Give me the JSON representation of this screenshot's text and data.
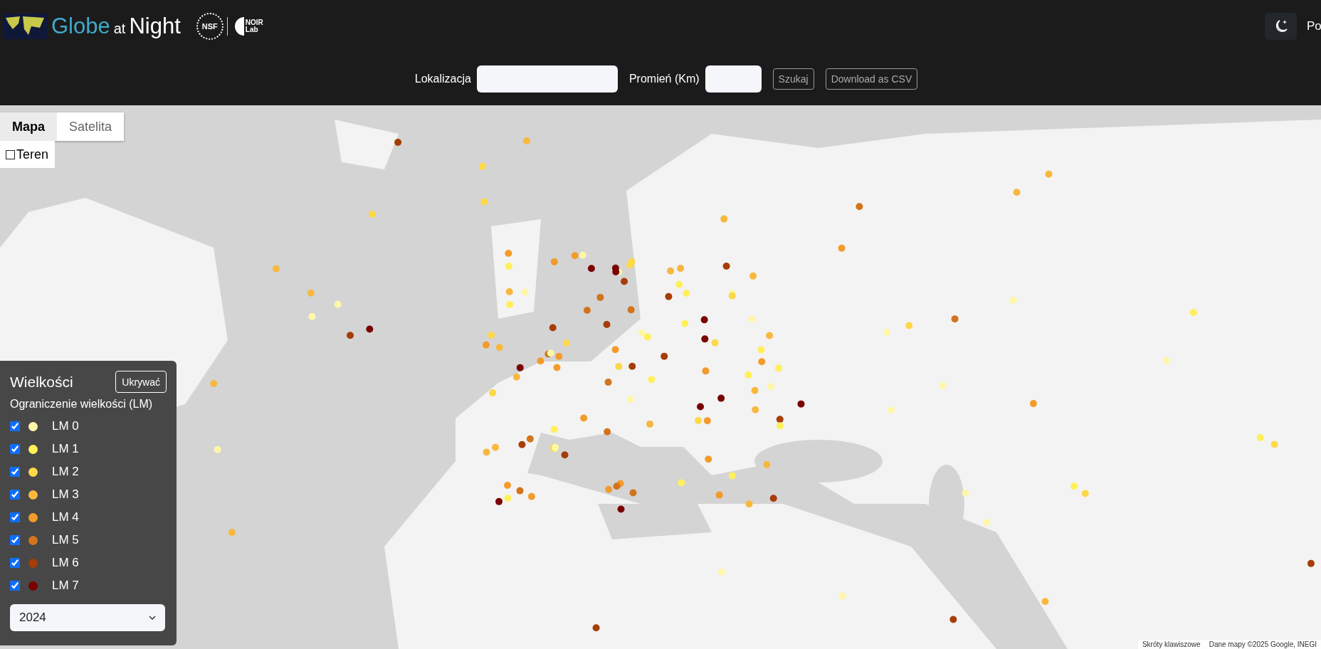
{
  "header": {
    "logo": {
      "globe": "Globe",
      "at": "at",
      "night": "Night",
      "nsf": "NSF",
      "noir": "NOIR",
      "lab": "Lab"
    },
    "menu_text": "Po"
  },
  "search": {
    "location_label": "Lokalizacja",
    "radius_label": "Promień (Km)",
    "buttons": [
      "Szukaj",
      "Download as CSV"
    ]
  },
  "map_type": {
    "tabs": [
      {
        "label": "Mapa",
        "selected": true
      },
      {
        "label": "Satelita",
        "selected": false
      }
    ],
    "terrain": {
      "label": "Teren",
      "checked": false
    }
  },
  "legend": {
    "title": "Wielkości",
    "hide_button": "Ukrywać",
    "subtitle": "Ograniczenie wielkości (LM)",
    "levels": [
      {
        "label": "LM 0",
        "checked": true,
        "color": "#fff7a8"
      },
      {
        "label": "LM 1",
        "checked": true,
        "color": "#fff05a"
      },
      {
        "label": "LM 2",
        "checked": true,
        "color": "#fdd847"
      },
      {
        "label": "LM 3",
        "checked": true,
        "color": "#f8b83f"
      },
      {
        "label": "LM 4",
        "checked": true,
        "color": "#f39b2b"
      },
      {
        "label": "LM 5",
        "checked": true,
        "color": "#d2741c"
      },
      {
        "label": "LM 6",
        "checked": true,
        "color": "#a63d07"
      },
      {
        "label": "LM 7",
        "checked": true,
        "color": "#7a0000"
      }
    ],
    "year": "2024"
  },
  "attribution": [
    "Skróty klawiszowe",
    "Dane mapy ©2025 Google, INEGI"
  ]
}
